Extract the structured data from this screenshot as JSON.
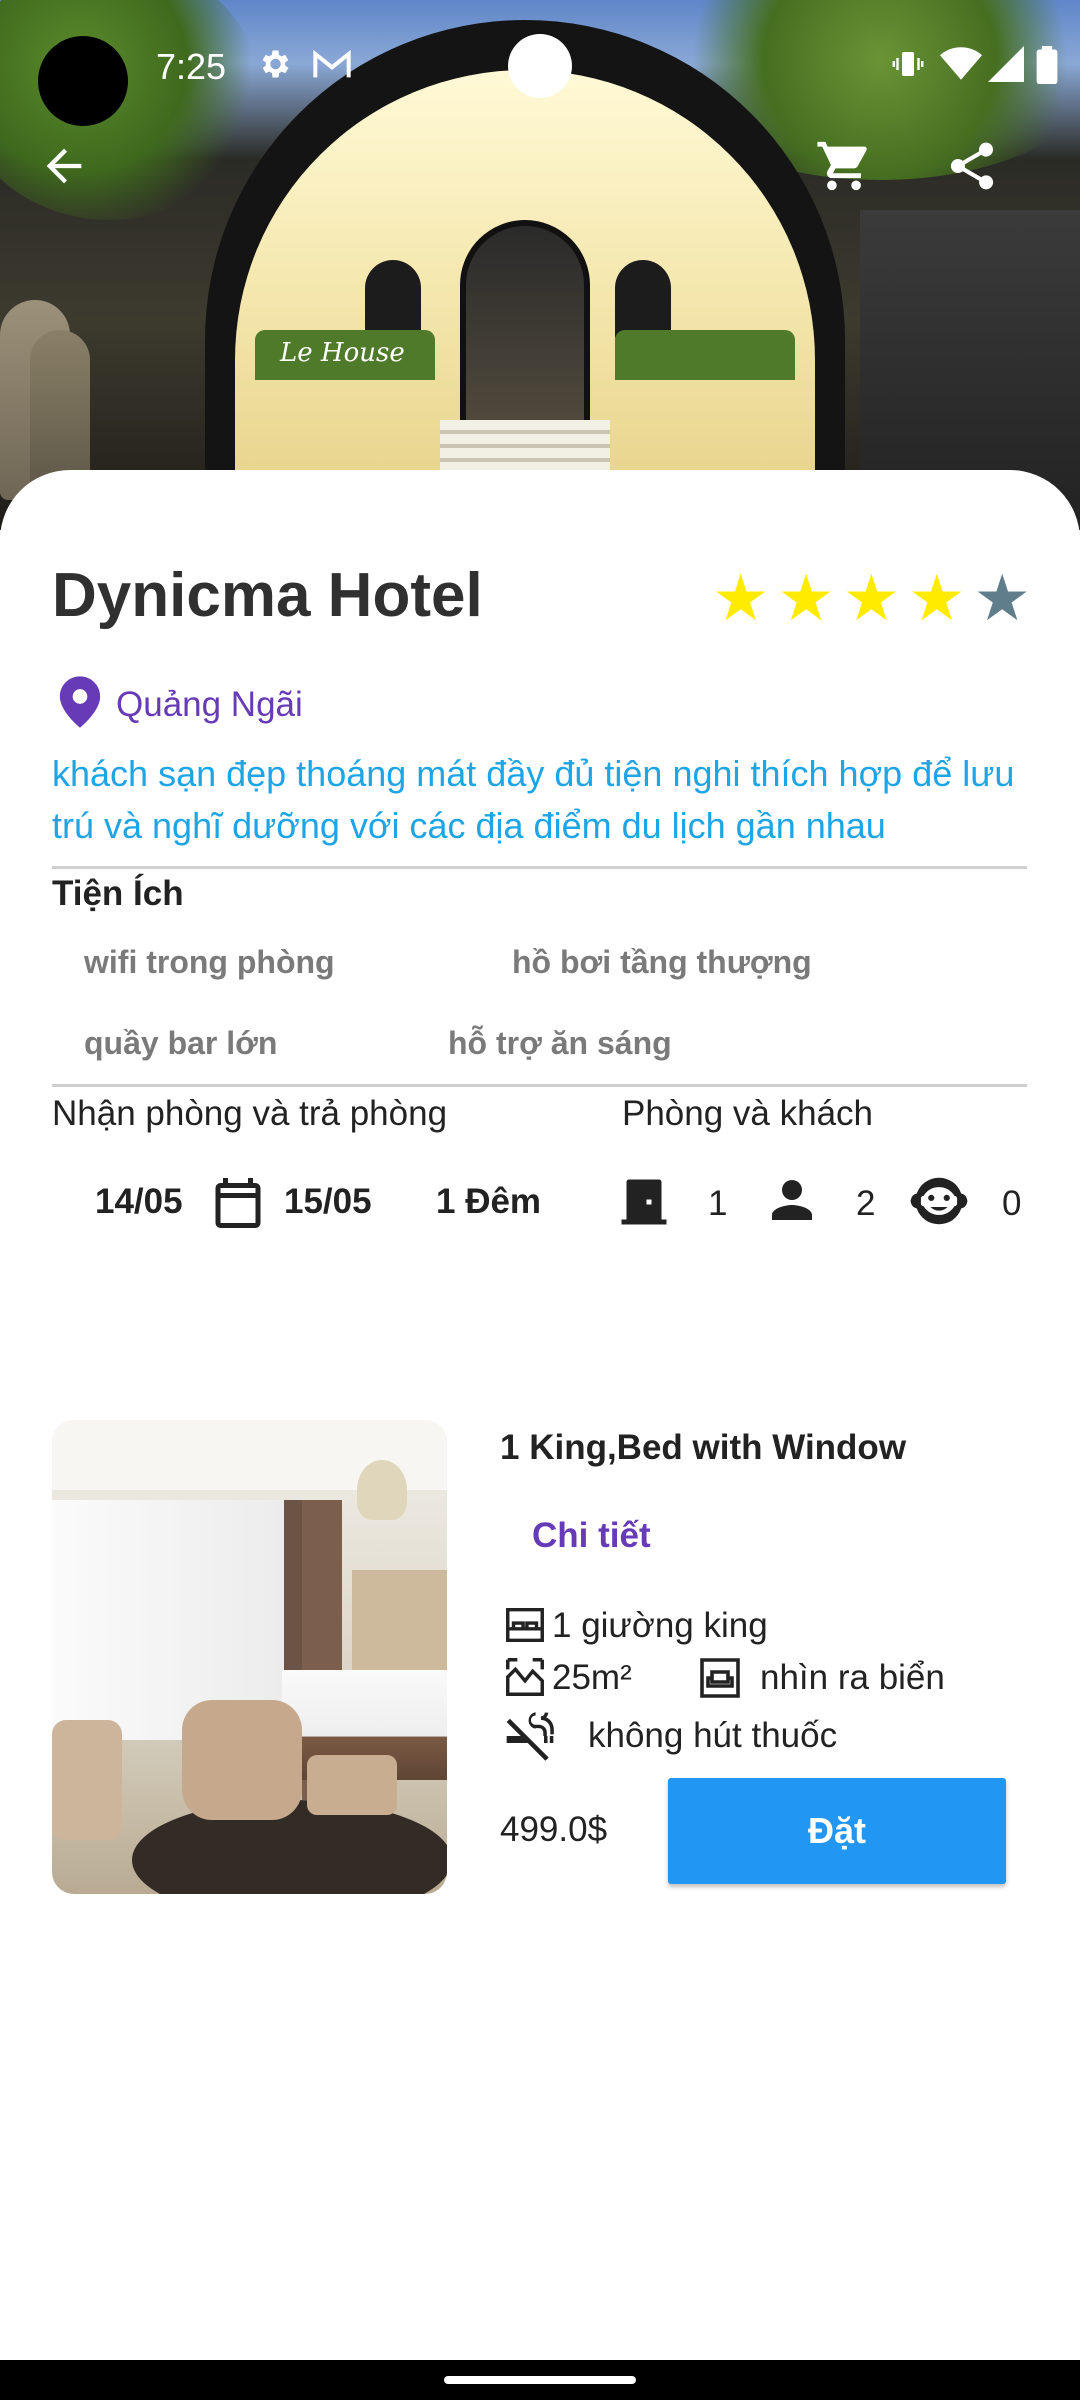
{
  "status_bar": {
    "time": "7:25"
  },
  "hotel": {
    "name": "Dynicma Hotel",
    "rating": 4,
    "max_rating": 5,
    "location": "Quảng Ngãi",
    "description": "khách sạn đẹp thoáng mát đầy đủ tiện nghi thích hợp để lưu trú và nghĩ dưỡng với các địa điểm du lịch gần nhau",
    "hero_sign": "Le House"
  },
  "amenities": {
    "title": "Tiện Ích",
    "items": [
      "wifi trong phòng",
      "hồ bơi tầng thượng",
      "quầy bar lớn",
      "hỗ trợ ăn sáng"
    ]
  },
  "booking": {
    "checkin_label": "Nhận phòng và trả phòng",
    "guests_label": "Phòng và khách",
    "checkin_date": "14/05",
    "checkout_date": "15/05",
    "nights": "1 Đêm",
    "rooms": "1",
    "adults": "2",
    "children": "0"
  },
  "room": {
    "title": "1 King,Bed with Window",
    "detail_link": "Chi tiết",
    "bed": "1 giường king",
    "area": "25m²",
    "view": "nhìn ra biển",
    "smoking": "không hút thuốc",
    "price": "499.0$",
    "book_label": "Đặt"
  },
  "colors": {
    "accent_purple": "#673ab7",
    "desc_blue": "#1ea5e6",
    "button_blue": "#2196f3",
    "star_yellow": "#ffeb00",
    "star_empty": "#607d8b"
  }
}
